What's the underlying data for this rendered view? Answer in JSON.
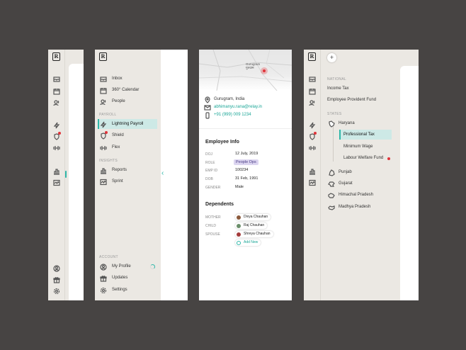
{
  "panel2": {
    "nav_inbox": "Inbox",
    "nav_calendar": "360° Calendar",
    "nav_people": "People",
    "section_payroll": "PAYROLL",
    "nav_lightning_payroll": "Lightning Payroll",
    "nav_shield": "Shield",
    "nav_flex": "Flex",
    "section_insights": "INSIGHTS",
    "nav_reports": "Reports",
    "nav_sprint": "Sprint",
    "section_account": "ACCOUNT",
    "nav_my_profile": "My Profile",
    "nav_updates": "Updates",
    "nav_settings": "Settings"
  },
  "profile": {
    "location": "Gurugram, India",
    "email": "abhimanyu.rana@relay.in",
    "phone": "+91 (999) 009 1234",
    "map_label": "Gurugram\nगुरुग्राम",
    "employee_info_title": "Employee Info",
    "doj_label": "DOJ",
    "doj_value": "12 July, 2019",
    "role_label": "ROLE",
    "role_value": "People Ops",
    "empid_label": "EMP ID",
    "empid_value": "100234",
    "dob_label": "DOB",
    "dob_value": "31 Feb, 1991",
    "gender_label": "GENDER",
    "gender_value": "Male",
    "dependents_title": "Dependents",
    "mother_label": "MOTHER",
    "mother_value": "Divya Chauhan",
    "child_label": "CHILD",
    "child_value": "Raj Chauhan",
    "spouse_label": "SPOUSE",
    "spouse_value": "Shreya Chauhan",
    "add_new": "Add New"
  },
  "tax": {
    "add_symbol": "+",
    "section_national": "NATIONAL",
    "income_tax": "Income Tax",
    "epf": "Employee Provident Fund",
    "section_states": "STATES",
    "haryana": "Haryana",
    "professional_tax": "Professional Tax",
    "minimum_wage": "Minimum Wage",
    "labour_welfare_fund": "Labour Welfare Fund",
    "punjab": "Punjab",
    "gujarat": "Gujarat",
    "himachal": "Himachal Pradesh",
    "madhya": "Madhya Pradesh"
  },
  "colors": {
    "accent": "#2fb7a9",
    "highlight": "#cde9e6",
    "alert": "#e0343a",
    "background": "#474443",
    "panel": "#ebe8e3"
  },
  "icons": [
    "logo-icon",
    "inbox-icon",
    "calendar-icon",
    "people-icon",
    "lightning-icon",
    "shield-icon",
    "flex-icon",
    "reports-icon",
    "sprint-icon",
    "profile-icon",
    "gift-icon",
    "settings-icon",
    "location-icon",
    "mail-icon",
    "phone-icon"
  ]
}
